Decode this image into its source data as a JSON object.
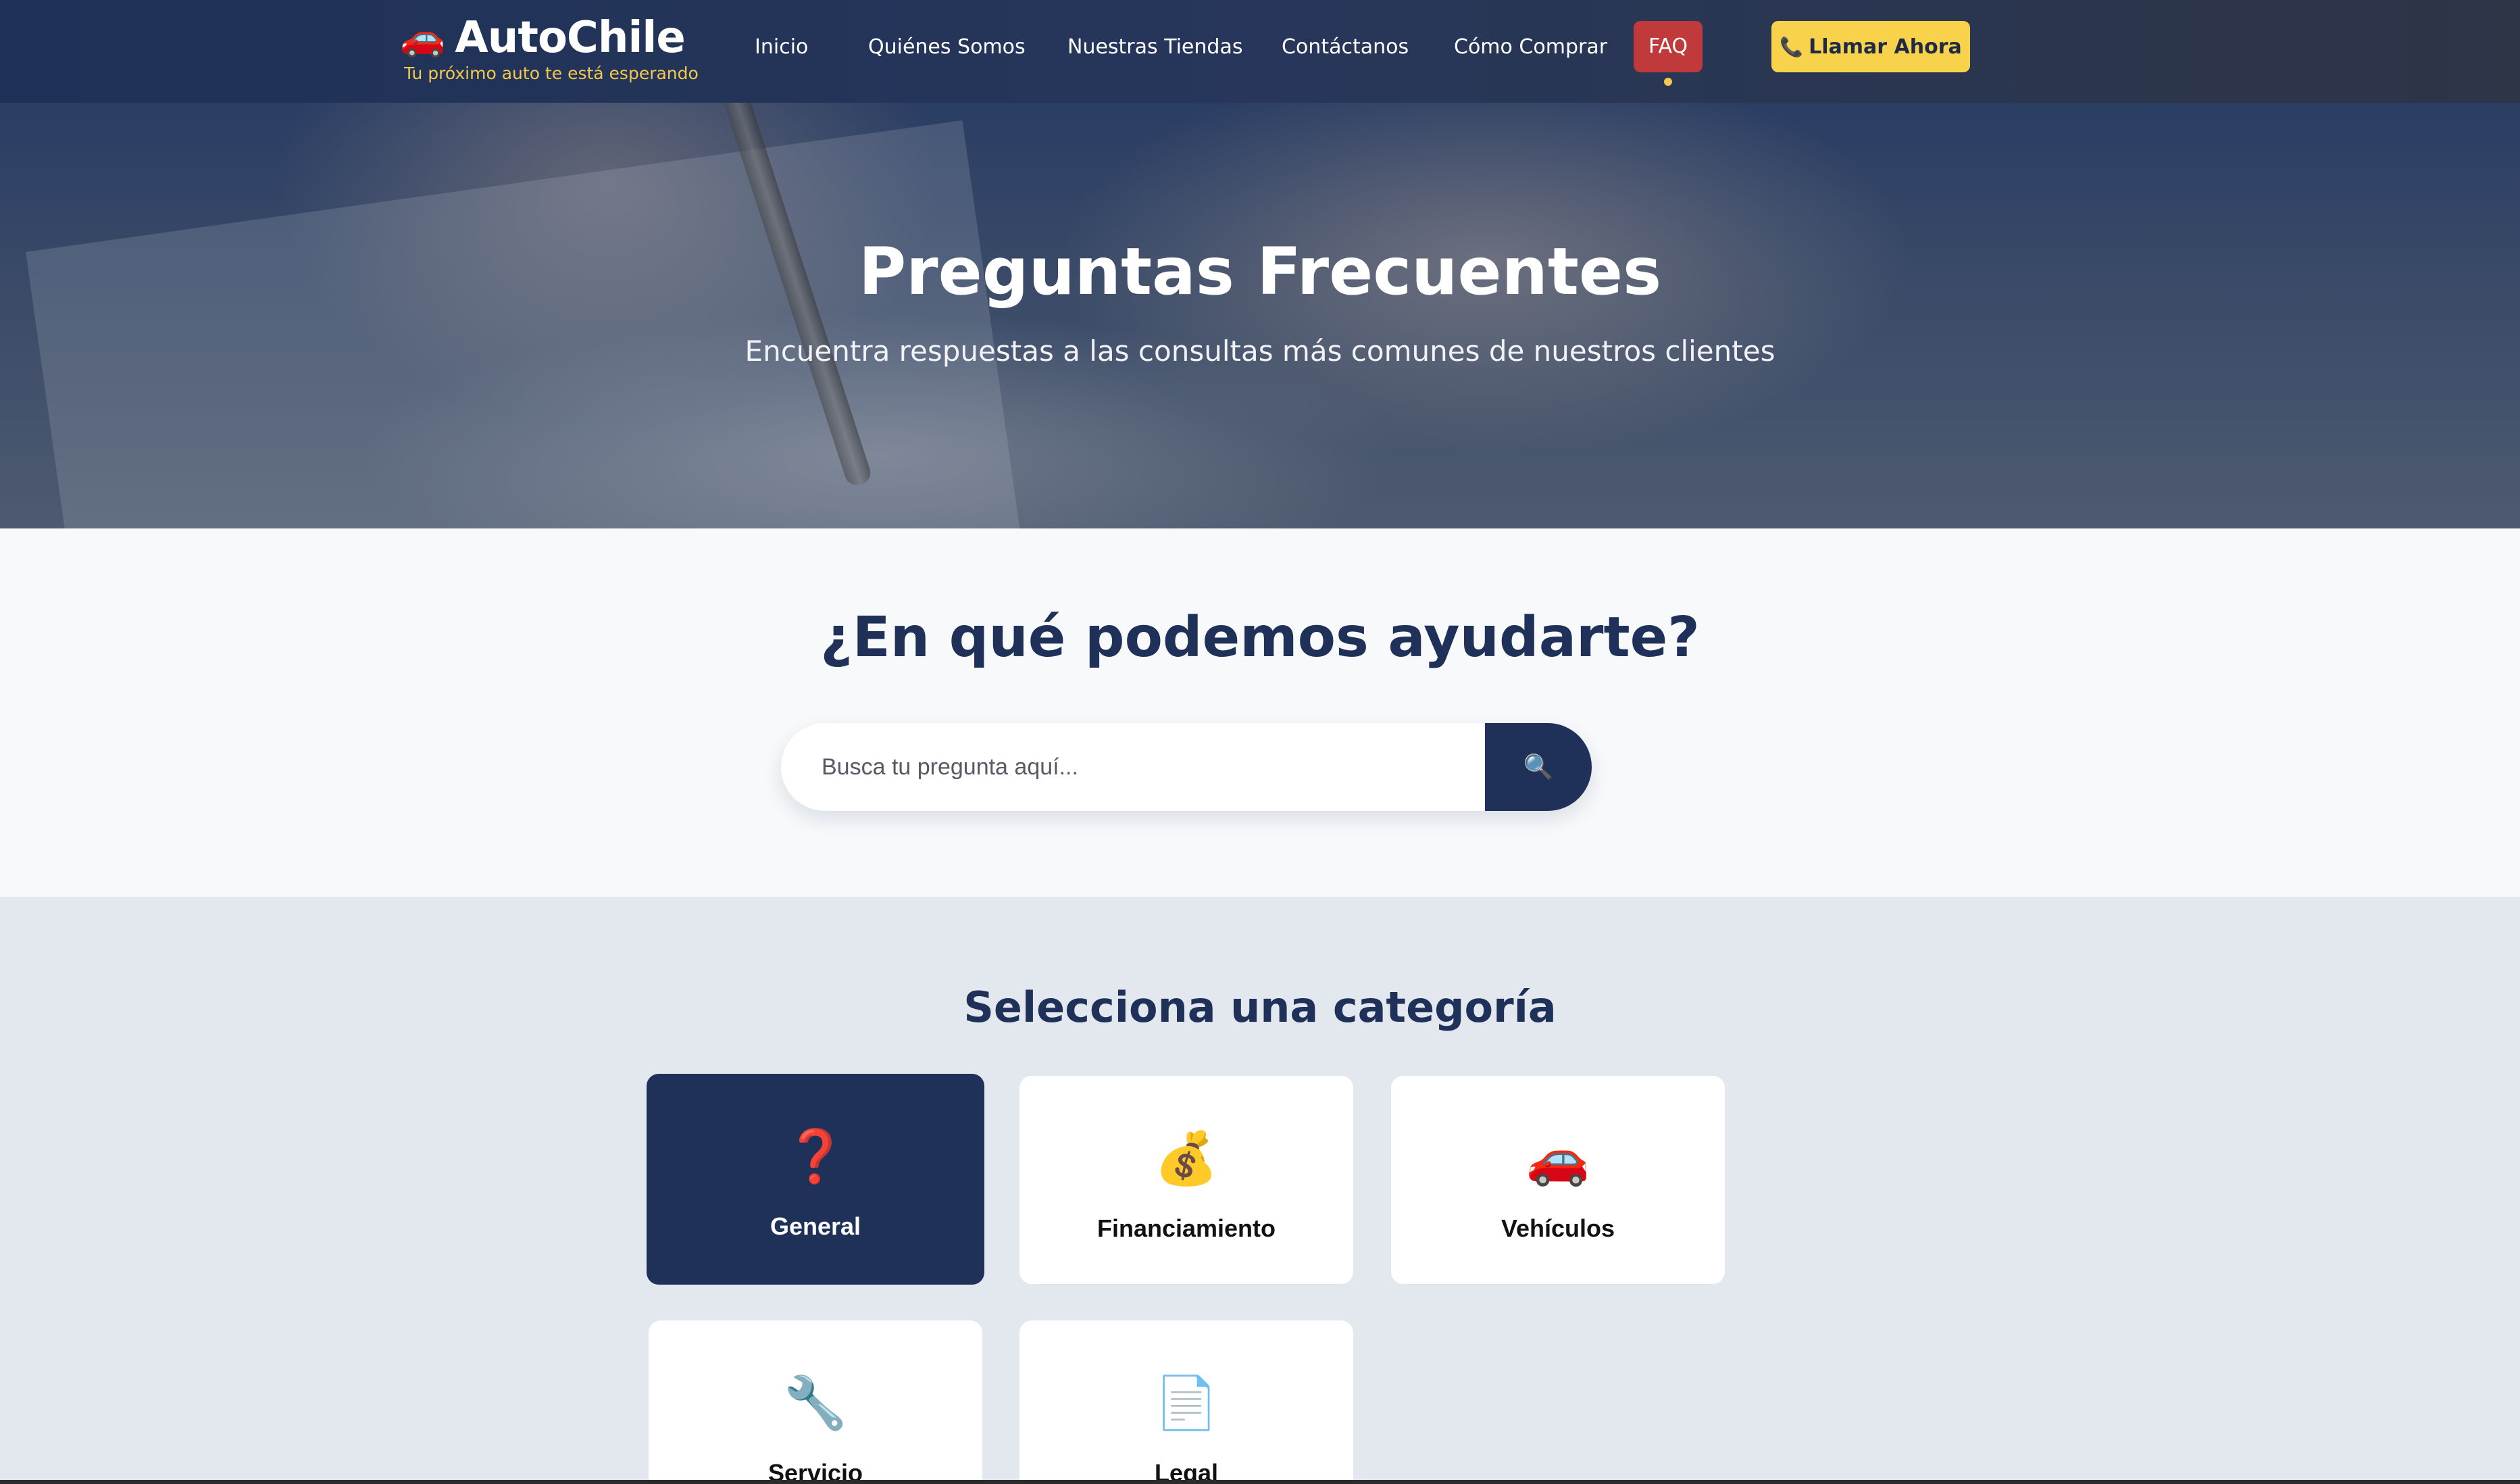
{
  "brand": {
    "icon": "car-emoji",
    "icon_glyph": "🚗",
    "name": "AutoChile",
    "tagline": "Tu próximo auto te está esperando"
  },
  "nav": {
    "items": [
      {
        "label": "Inicio"
      },
      {
        "label": "Quiénes Somos"
      },
      {
        "label": "Nuestras Tiendas"
      },
      {
        "label": "Contáctanos"
      },
      {
        "label": "Cómo Comprar"
      }
    ],
    "active_label": "FAQ",
    "call_icon": "📞",
    "call_label": "Llamar Ahora"
  },
  "hero": {
    "title": "Preguntas Frecuentes",
    "subtitle": "Encuentra respuestas a las consultas más comunes de nuestros clientes"
  },
  "search": {
    "title": "¿En qué podemos ayudarte?",
    "placeholder": "Busca tu pregunta aquí...",
    "button_icon": "🔍"
  },
  "categories": {
    "title": "Selecciona una categoría",
    "items": [
      {
        "icon": "❓",
        "label": "General",
        "active": true
      },
      {
        "icon": "💰",
        "label": "Financiamiento",
        "active": false
      },
      {
        "icon": "🚗",
        "label": "Vehículos",
        "active": false
      },
      {
        "icon": "🔧",
        "label": "Servicio",
        "active": false
      },
      {
        "icon": "📄",
        "label": "Legal",
        "active": false
      }
    ]
  },
  "colors": {
    "navy": "#1f3158",
    "accent_red": "#c0393b",
    "accent_yellow": "#f8d24a",
    "section_bg": "#e3e8ef"
  }
}
